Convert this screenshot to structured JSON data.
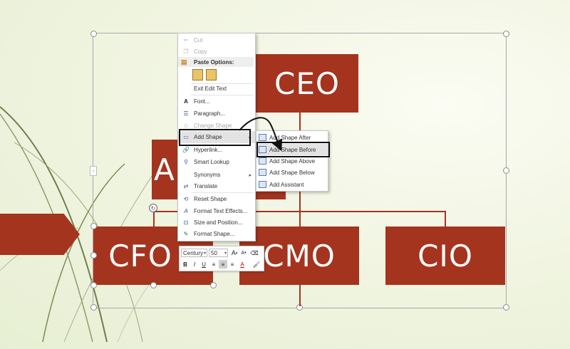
{
  "org_chart": {
    "ceo": "CEO",
    "assistant_partial": "A",
    "cfo": "CFO",
    "cmo": "CMO",
    "cio": "CIO"
  },
  "context_menu": {
    "cut": "Cut",
    "copy": "Copy",
    "paste_options": "Paste Options:",
    "exit_edit_text": "Exit Edit Text",
    "font": "Font...",
    "paragraph": "Paragraph...",
    "change_shape": "Change Shape",
    "add_shape": "Add Shape",
    "hyperlink": "Hyperlink...",
    "smart_lookup": "Smart Lookup",
    "synonyms": "Synonyms",
    "translate": "Translate",
    "reset_shape": "Reset Shape",
    "format_text_effects": "Format Text Effects...",
    "size_and_position": "Size and Position...",
    "format_shape": "Format Shape..."
  },
  "add_shape_submenu": {
    "after": "Add Shape After",
    "before": "Add Shape Before",
    "above": "Add Shape Above",
    "below": "Add Shape Below",
    "assistant": "Add Assistant"
  },
  "mini_toolbar": {
    "font_name": "Century",
    "font_size": "50",
    "grow_font": "A",
    "shrink_font": "A",
    "bold": "B",
    "italic": "I",
    "underline": "U",
    "font_color": "A"
  },
  "colors": {
    "accent": "#a5341f",
    "background": "#f1f5e2",
    "menu_highlight": "#e3e3e3"
  }
}
